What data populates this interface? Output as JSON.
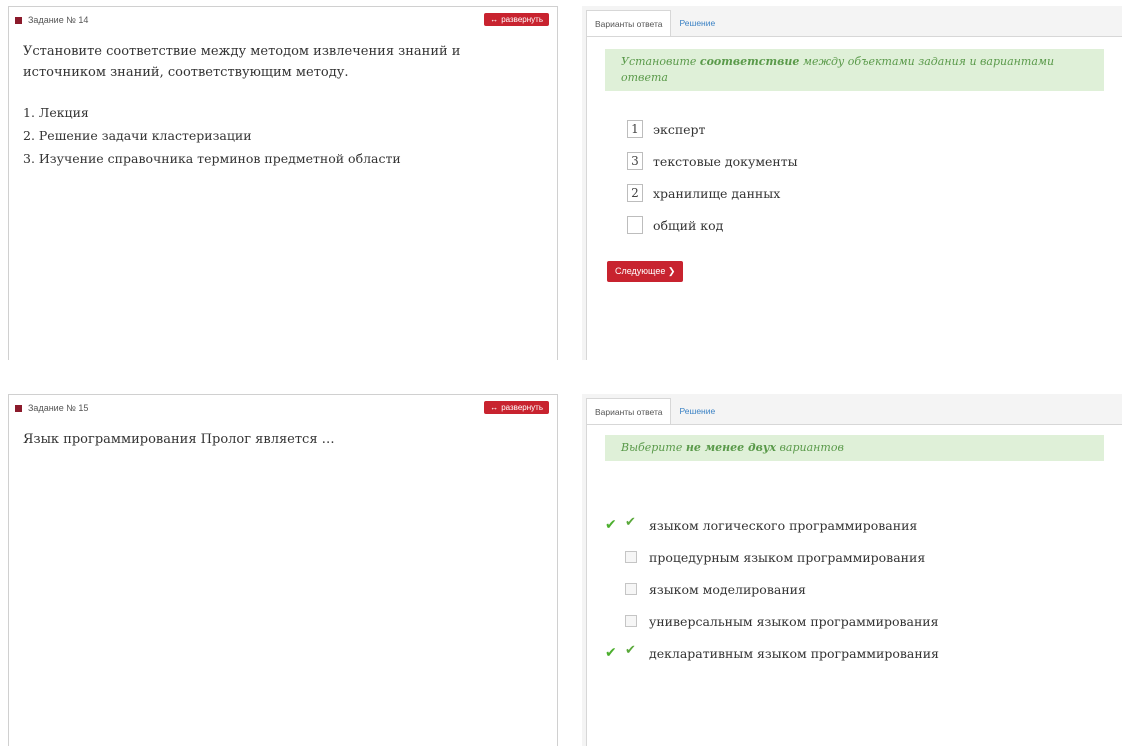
{
  "colors": {
    "accent": "#c8232f",
    "hint_bg": "#dff0d8",
    "hint_text": "#5a9a4a",
    "tab_link": "#3b82c4"
  },
  "task1": {
    "header": "Задание № 14",
    "expand_label": "развернуть",
    "question": "Установите соответствие между методом извлечения знаний и источником знаний, соответствующим методу.",
    "items": [
      "1. Лекция",
      "2. Решение задачи кластеризации",
      "3. Изучение справочника терминов предметной области"
    ],
    "tabs": [
      "Варианты ответа",
      "Решение"
    ],
    "hint_pre": "Установите ",
    "hint_bold": "соответствие",
    "hint_post": " между объектами задания и вариантами ответа",
    "options": [
      {
        "num": "1",
        "label": "эксперт"
      },
      {
        "num": "3",
        "label": "текстовые документы"
      },
      {
        "num": "2",
        "label": "хранилище данных"
      },
      {
        "num": "",
        "label": "общий код"
      }
    ],
    "next_label": "Следующее"
  },
  "task2": {
    "header": "Задание № 15",
    "expand_label": "развернуть",
    "question": "Язык программирования Пролог является …",
    "tabs": [
      "Варианты ответа",
      "Решение"
    ],
    "hint_pre": "Выберите ",
    "hint_bold": "не менее двух",
    "hint_post": " вариантов",
    "options": [
      {
        "label": "языком логического программирования",
        "checked": true,
        "correct": true
      },
      {
        "label": "процедурным языком программирования",
        "checked": false,
        "correct": false
      },
      {
        "label": "языком моделирования",
        "checked": false,
        "correct": false
      },
      {
        "label": "универсальным языком программирования",
        "checked": false,
        "correct": false
      },
      {
        "label": "декларативным языком программирования",
        "checked": true,
        "correct": true
      }
    ]
  }
}
